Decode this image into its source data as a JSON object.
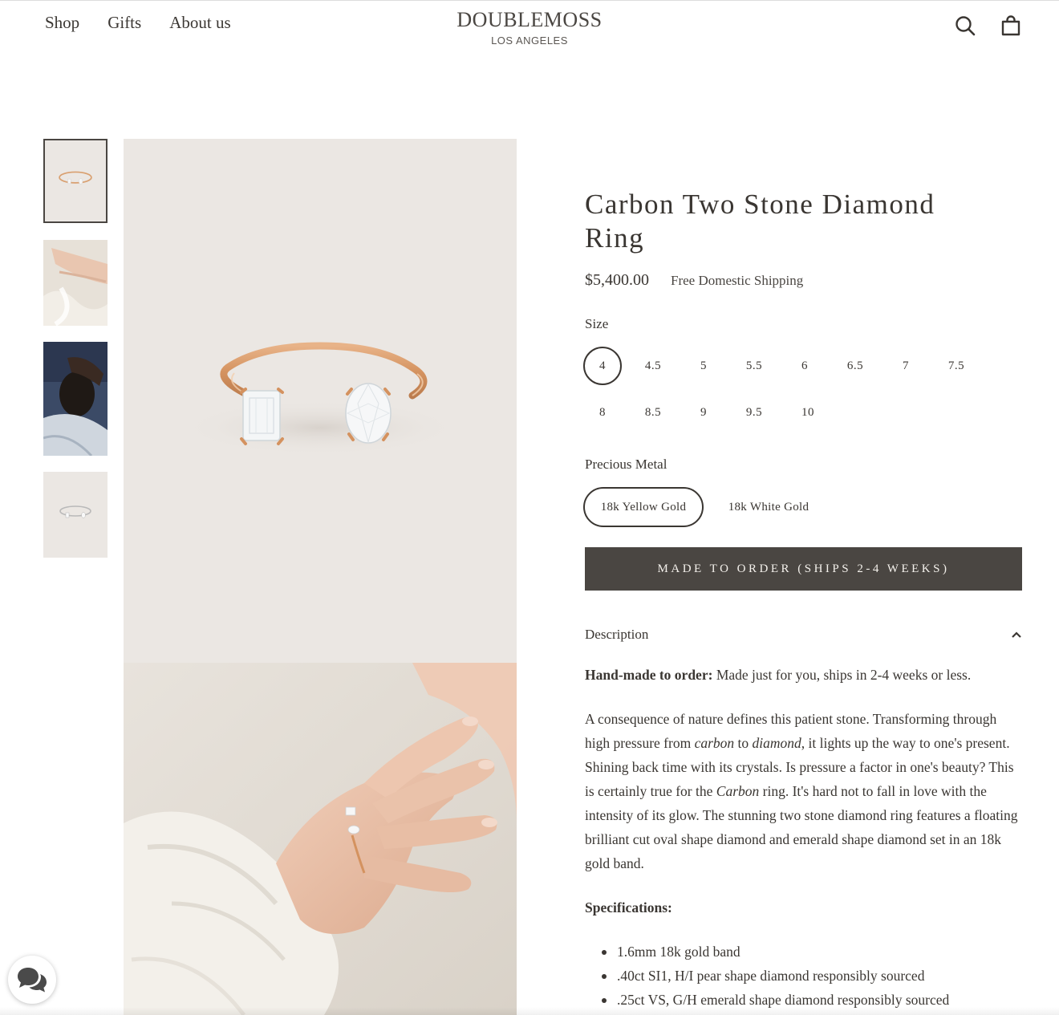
{
  "header": {
    "nav": [
      "Shop",
      "Gifts",
      "About us"
    ],
    "brand": "DOUBLEMOSS",
    "city": "LOS ANGELES",
    "search_icon": "search-icon",
    "cart_icon": "cart-icon"
  },
  "gallery": {
    "thumbnails": [
      "ring-product-photo",
      "hand-with-ring-photo",
      "dark-portrait-photo",
      "white-gold-ring-photo"
    ],
    "colors": {
      "backdrop": "#ebe7e3",
      "rose_gold": "#d99a6c"
    }
  },
  "product": {
    "title": "Carbon Two Stone Diamond Ring",
    "price": "$5,400.00",
    "shipping": "Free Domestic Shipping",
    "size_label": "Size",
    "sizes": [
      "4",
      "4.5",
      "5",
      "5.5",
      "6",
      "6.5",
      "7",
      "7.5",
      "8",
      "8.5",
      "9",
      "9.5",
      "10"
    ],
    "selected_size": "4",
    "metal_label": "Precious Metal",
    "metals": [
      "18k Yellow Gold",
      "18k White Gold"
    ],
    "selected_metal": "18k Yellow Gold",
    "cta": "MADE TO ORDER (SHIPS 2-4 WEEKS)",
    "cta_color": "#4a4642"
  },
  "description": {
    "toggle_label": "Description",
    "handmade_label": "Hand-made to order:",
    "handmade_text": " Made just for you, ships in 2-4 weeks or less.",
    "p1": "A consequence of nature defines this patient stone. Transforming through high pressure from ",
    "carbon_word": "carbon",
    "to_word": " to ",
    "diamond_word": "diamond",
    "p2": ", it lights up the way to one's present. Shining back time with its crystals. Is pressure a factor in one's beauty? This is certainly true for the ",
    "carbon_ring_word": "Carbon",
    "p3": " ring. It's hard not to fall in love with the intensity of its glow. The stunning two stone diamond ring features a floating brilliant cut oval shape diamond and emerald shape diamond set in an 18k gold band.",
    "specs_label": "Specifications:",
    "specs": [
      "1.6mm 18k gold band",
      ".40ct SI1, H/I  pear shape diamond responsibly sourced",
      ".25ct VS, G/H emerald shape diamond responsibly sourced"
    ]
  },
  "chat": {
    "icon": "chat-bubbles-icon"
  }
}
